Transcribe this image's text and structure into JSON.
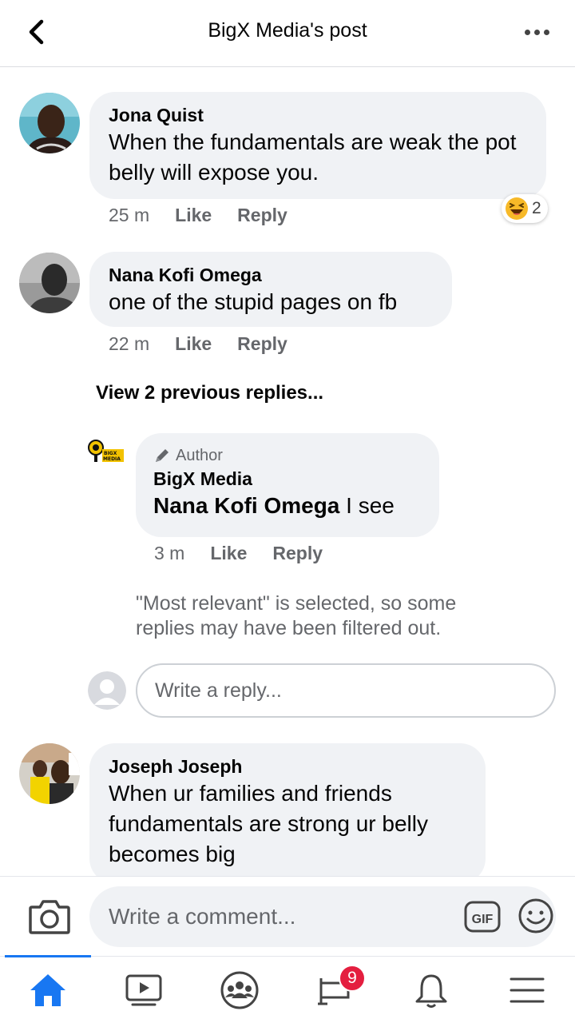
{
  "header": {
    "title": "BigX Media's post"
  },
  "comments": [
    {
      "author": "Jona Quist",
      "text": "When the fundamentals are weak  the pot  belly will expose you.",
      "time": "25 m",
      "like_label": "Like",
      "reply_label": "Reply",
      "reaction_count": "2"
    },
    {
      "author": "Nana Kofi Omega",
      "text": "one of the stupid pages on fb",
      "time": "22 m",
      "like_label": "Like",
      "reply_label": "Reply"
    },
    {
      "author": "Joseph Joseph",
      "text": "When ur families and friends fundamentals are strong ur belly becomes big"
    }
  ],
  "view_previous_replies": "View 2 previous replies...",
  "reply": {
    "author_badge": "Author",
    "author": "BigX Media",
    "mention": "Nana Kofi Omega",
    "text": " I see",
    "time": "3 m",
    "like_label": "Like",
    "reply_label": "Reply",
    "logo_text_top": "BIGX",
    "logo_text_bottom": "MEDIA"
  },
  "filter_note": "\"Most relevant\" is selected, so some replies may have been filtered out.",
  "write_reply_placeholder": "Write a reply...",
  "composer": {
    "placeholder": "Write a comment...",
    "gif_label": "GIF"
  },
  "bottom_nav": {
    "items": [
      "home-icon",
      "watch-icon",
      "groups-icon",
      "feeds-icon",
      "notifications-icon",
      "menu-icon"
    ],
    "badge": "9",
    "active_color": "#1877f2"
  }
}
